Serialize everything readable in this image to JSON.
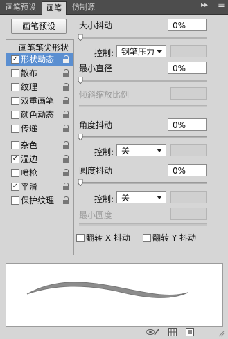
{
  "tabs": [
    {
      "label": "画笔预设"
    },
    {
      "label": "画笔"
    },
    {
      "label": "仿制源"
    }
  ],
  "preset_button": "画笔预设",
  "list": {
    "header": "画笔笔尖形状",
    "items": [
      {
        "label": "形状动态",
        "checked": true,
        "selected": true
      },
      {
        "label": "散布",
        "checked": false
      },
      {
        "label": "纹理",
        "checked": false
      },
      {
        "label": "双重画笔",
        "checked": false
      },
      {
        "label": "颜色动态",
        "checked": false
      },
      {
        "label": "传递",
        "checked": false
      },
      {
        "label": "杂色",
        "checked": false
      },
      {
        "label": "湿边",
        "checked": true
      },
      {
        "label": "喷枪",
        "checked": false
      },
      {
        "label": "平滑",
        "checked": true
      },
      {
        "label": "保护纹理",
        "checked": false
      }
    ]
  },
  "size_jitter": {
    "label": "大小抖动",
    "value": "0%"
  },
  "control1": {
    "label": "控制:",
    "value": "钢笔压力"
  },
  "min_diameter": {
    "label": "最小直径",
    "value": "0%"
  },
  "tilt_scale": {
    "label": "倾斜缩放比例"
  },
  "angle_jitter": {
    "label": "角度抖动",
    "value": "0%"
  },
  "control2": {
    "label": "控制:",
    "value": "关"
  },
  "roundness_jitter": {
    "label": "圆度抖动",
    "value": "0%"
  },
  "control3": {
    "label": "控制:",
    "value": "关"
  },
  "min_roundness": {
    "label": "最小圆度"
  },
  "flip_x": {
    "label": "翻转 X 抖动",
    "checked": false
  },
  "flip_y": {
    "label": "翻转 Y 抖动",
    "checked": false
  },
  "check_mark": "✓",
  "icons": {
    "panel_menu": "panel-menu-icon",
    "preview_toggle": "eye-brush-icon",
    "grid": "grid-icon",
    "new": "new-preset-icon"
  }
}
